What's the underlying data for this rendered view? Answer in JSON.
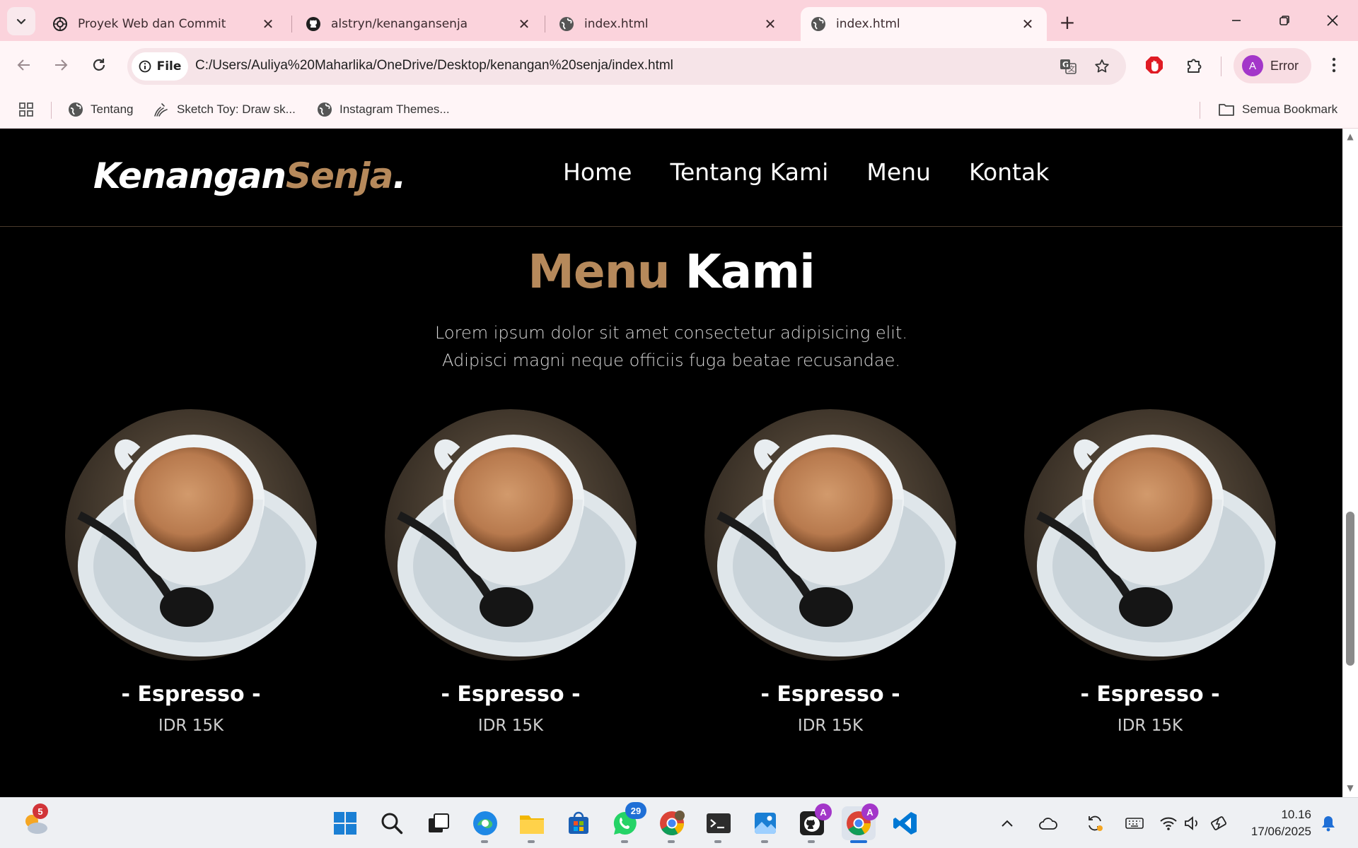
{
  "browser": {
    "tabs": [
      {
        "title": "Proyek Web dan Commit",
        "icon": "chatgpt-icon"
      },
      {
        "title": "alstryn/kenangansenja",
        "icon": "github-icon"
      },
      {
        "title": "index.html",
        "icon": "globe-icon"
      },
      {
        "title": "index.html",
        "icon": "globe-icon",
        "active": true
      }
    ],
    "address": {
      "chip_label": "File",
      "url": "C:/Users/Auliya%20Maharlika/OneDrive/Desktop/kenangan%20senja/index.html"
    },
    "profile": {
      "initial": "A",
      "label": "Error"
    },
    "bookmarks": [
      {
        "label": "Tentang",
        "icon": "globe-icon"
      },
      {
        "label": "Sketch Toy: Draw sk...",
        "icon": "sketch-icon"
      },
      {
        "label": "Instagram Themes...",
        "icon": "globe-icon"
      }
    ],
    "all_bookmarks_label": "Semua Bookmark"
  },
  "site": {
    "logo": {
      "part1": "Kenangan",
      "part2": "Senja",
      "dot": "."
    },
    "nav": [
      "Home",
      "Tentang Kami",
      "Menu",
      "Kontak"
    ],
    "section": {
      "title_accent": "Menu",
      "title_rest": "Kami",
      "desc_line1": "Lorem ipsum dolor sit amet consectetur adipisicing elit.",
      "desc_line2": "Adipisci magni neque officiis fuga beatae recusandae."
    },
    "menu_items": [
      {
        "name": "- Espresso -",
        "price": "IDR 15K"
      },
      {
        "name": "- Espresso -",
        "price": "IDR 15K"
      },
      {
        "name": "- Espresso -",
        "price": "IDR 15K"
      },
      {
        "name": "- Espresso -",
        "price": "IDR 15K"
      }
    ],
    "colors": {
      "accent": "#b6895b",
      "background": "#000000"
    }
  },
  "taskbar": {
    "weather_badge": "5",
    "whatsapp_badge": "29",
    "github_badge": "A",
    "chrome_badge": "A",
    "time": "10.16",
    "date": "17/06/2025"
  }
}
